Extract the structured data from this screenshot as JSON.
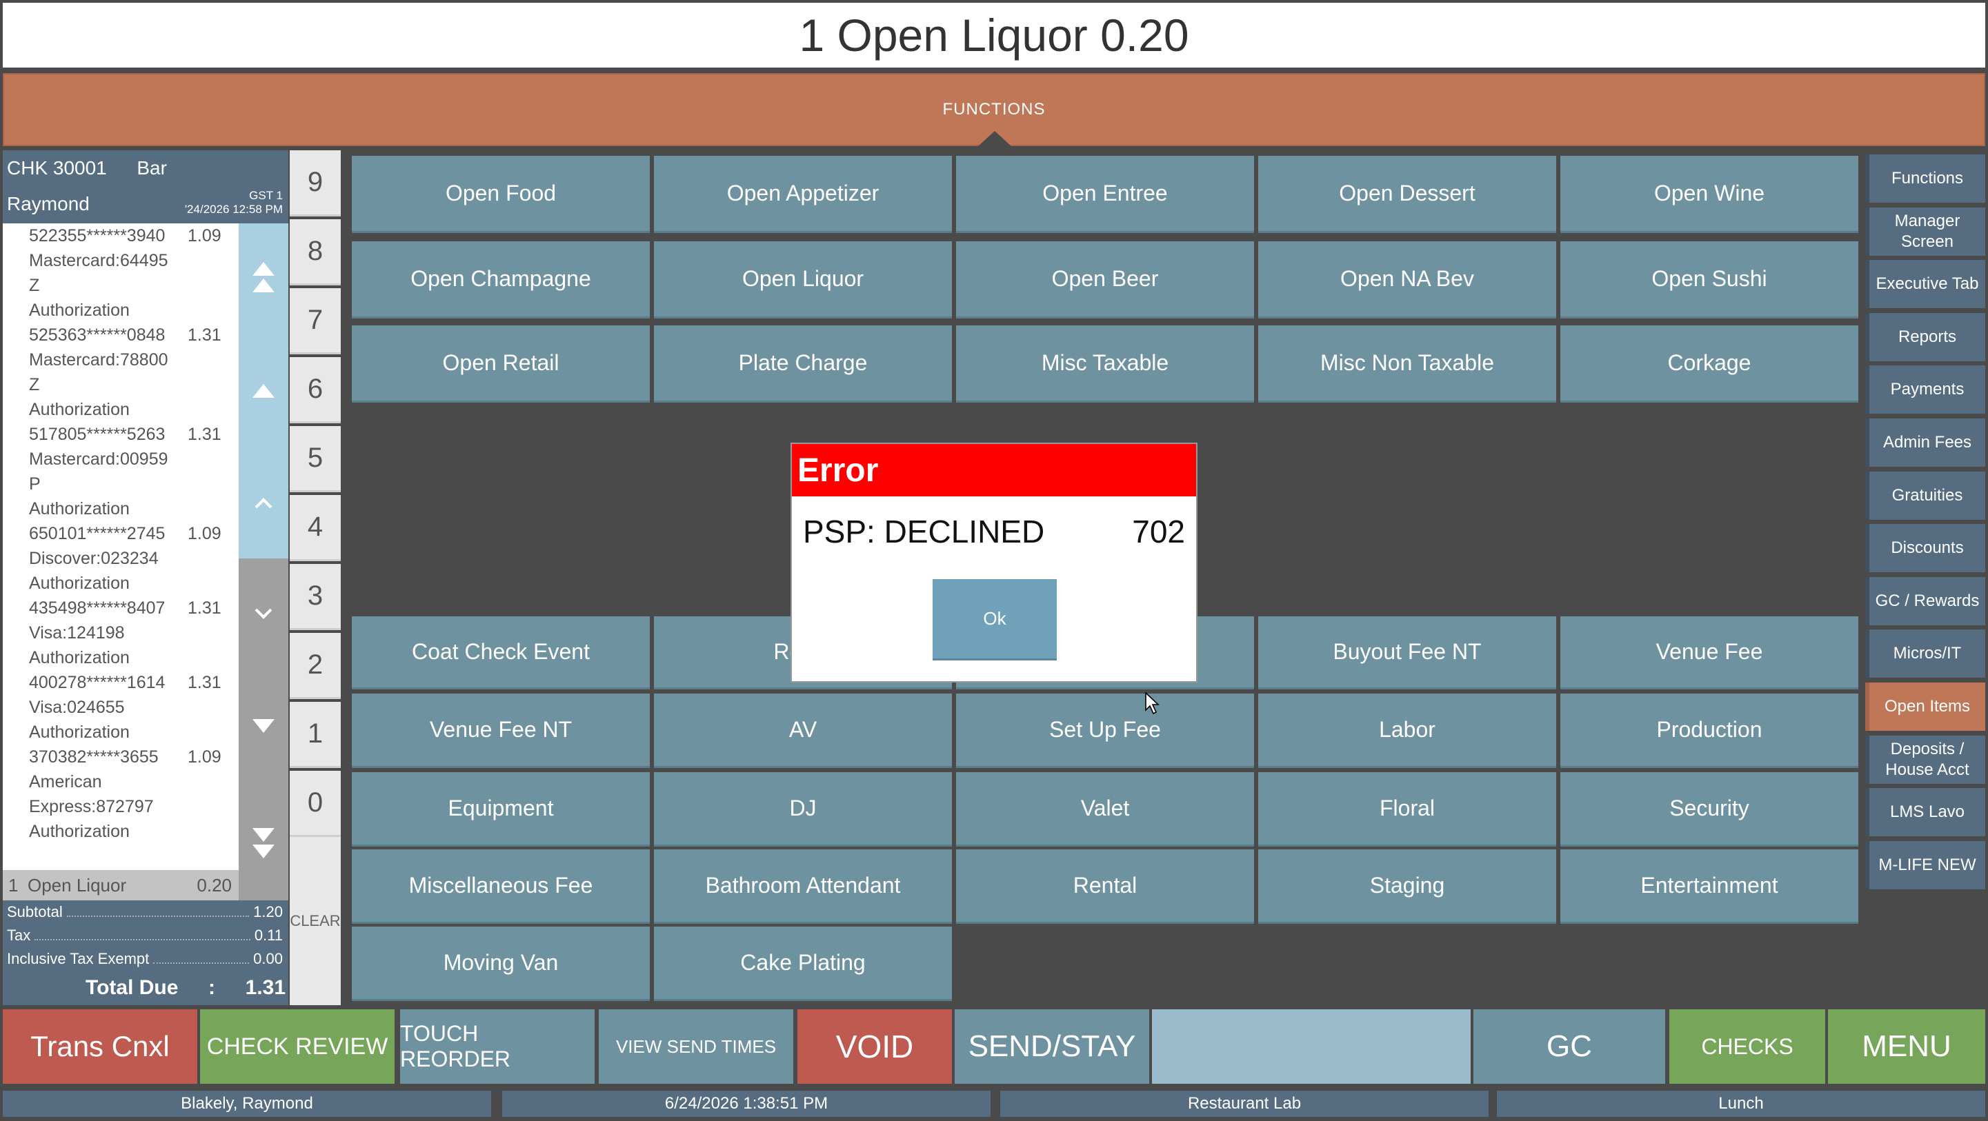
{
  "title": "1 Open Liquor 0.20",
  "functions_label": "FUNCTIONS",
  "check": {
    "number": "CHK 30001",
    "table": "Bar",
    "server": "Raymond",
    "gst": "GST 1",
    "datetime": "'24/2026 12:58 PM",
    "payments": [
      {
        "card": "522355******3940",
        "amount": "1.09",
        "lines": [
          "Mastercard:64495",
          "Z",
          "Authorization"
        ]
      },
      {
        "card": "525363******0848",
        "amount": "1.31",
        "lines": [
          "Mastercard:78800",
          "Z",
          "Authorization"
        ]
      },
      {
        "card": "517805******5263",
        "amount": "1.31",
        "lines": [
          "Mastercard:00959",
          "P",
          "Authorization"
        ]
      },
      {
        "card": "650101******2745",
        "amount": "1.09",
        "lines": [
          "Discover:023234",
          "Authorization"
        ]
      },
      {
        "card": "435498******8407",
        "amount": "1.31",
        "lines": [
          "Visa:124198",
          "Authorization"
        ]
      },
      {
        "card": "400278******1614",
        "amount": "1.31",
        "lines": [
          "Visa:024655",
          "Authorization"
        ]
      },
      {
        "card": "370382*****3655",
        "amount": "1.09",
        "lines": [
          "American",
          "Express:872797",
          "Authorization"
        ]
      }
    ],
    "selected_item": {
      "index": "1",
      "name": "Open Liquor",
      "amount": "0.20"
    },
    "subtotal_label": "Subtotal",
    "subtotal": "1.20",
    "tax_label": "Tax",
    "tax": "0.11",
    "exempt_label": "Inclusive Tax Exempt",
    "exempt": "0.00",
    "total_label": "Total Due",
    "total_sep": ":",
    "total": "1.31"
  },
  "numpad": [
    "9",
    "8",
    "7",
    "6",
    "5",
    "4",
    "3",
    "2",
    "1",
    "0"
  ],
  "clear_label": "CLEAR",
  "grid_top": [
    [
      "Open Food",
      "Open Appetizer",
      "Open Entree",
      "Open Dessert",
      "Open Wine"
    ],
    [
      "Open Champagne",
      "Open Liquor",
      "Open Beer",
      "Open NA Bev",
      "Open Sushi"
    ],
    [
      "Open Retail",
      "Plate Charge",
      "Misc Taxable",
      "Misc Non Taxable",
      "Corkage"
    ]
  ],
  "grid_bottom": [
    [
      "Coat Check Event",
      "Room",
      "",
      "Buyout Fee NT",
      "Venue Fee"
    ],
    [
      "Venue Fee NT",
      "AV",
      "Set Up Fee",
      "Labor",
      "Production"
    ],
    [
      "Equipment",
      "DJ",
      "Valet",
      "Floral",
      "Security"
    ],
    [
      "Miscellaneous Fee",
      "Bathroom Attendant",
      "Rental",
      "Staging",
      "Entertainment"
    ],
    [
      "Moving Van",
      "Cake Plating"
    ]
  ],
  "sidebar": [
    "Functions",
    "Manager Screen",
    "Executive Tab",
    "Reports",
    "Payments",
    "Admin Fees",
    "Gratuities",
    "Discounts",
    "GC / Rewards",
    "Micros/IT",
    "Open Items",
    "Deposits / House Acct",
    "LMS Lavo",
    "M-LIFE NEW"
  ],
  "dialog": {
    "title": "Error",
    "message": "PSP: DECLINED",
    "code": "702",
    "ok_label": "Ok"
  },
  "bottom_buttons": [
    "Trans Cnxl",
    "CHECK REVIEW",
    "TOUCH REORDER",
    "VIEW SEND TIMES",
    "VOID",
    "SEND/STAY",
    "",
    "GC",
    "CHECKS",
    "MENU"
  ],
  "status": {
    "user": "Blakely, Raymond",
    "datetime": "6/24/2026 1:38:51 PM",
    "location": "Restaurant Lab",
    "period": "Lunch"
  },
  "colors": {
    "brand": "#bf7757",
    "tile": "#6f92a0",
    "error": "#ff0000",
    "panel": "#566c80"
  }
}
